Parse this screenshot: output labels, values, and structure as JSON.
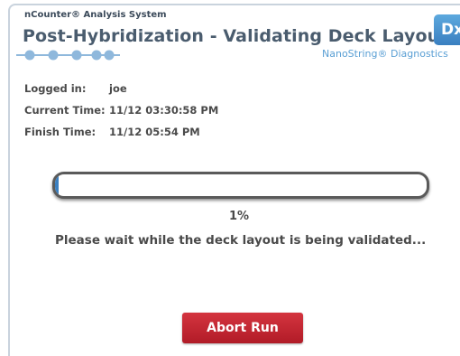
{
  "header": {
    "system_name": "nCounter® Analysis System",
    "title": "Post-Hybridization - Validating Deck Layout",
    "brand": "NanoString® Diagnostics",
    "badge": "Dx"
  },
  "steps": {
    "total": 5
  },
  "info": {
    "logged_in_label": "Logged in:",
    "logged_in_value": "joe",
    "current_time_label": "Current Time:",
    "current_time_value": "11/12 03:30:58 PM",
    "finish_time_label": "Finish Time:",
    "finish_time_value": "11/12 05:54 PM"
  },
  "progress": {
    "percent_text": "1%",
    "fraction": 0.01,
    "message": "Please wait while the deck layout is being validated..."
  },
  "actions": {
    "abort_label": "Abort Run"
  },
  "colors": {
    "accent": "#3a7fc0",
    "abort": "#c0222e",
    "brand_text": "#5a9fd4"
  }
}
